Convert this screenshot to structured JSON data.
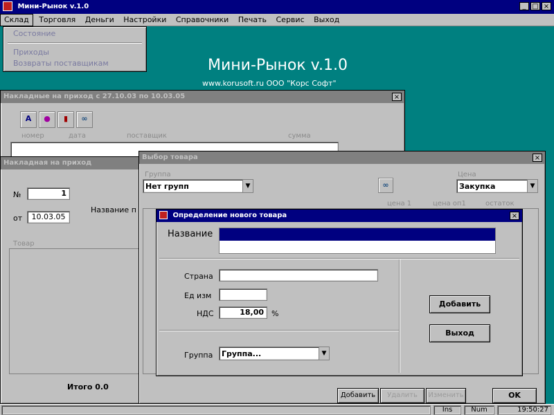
{
  "app": {
    "title": "Мини-Рынок v.1.0",
    "heading": "Мини-Рынок v.1.0",
    "site": "www.korusoft.ru  ООО \"Корс Софт\""
  },
  "menu": {
    "items": [
      "Склад",
      "Торговля",
      "Деньги",
      "Настройки",
      "Справочники",
      "Печать",
      "Сервис",
      "Выход"
    ],
    "dropdown": [
      "Состояние",
      "Приходы",
      "Возвраты поставщикам"
    ]
  },
  "win_invoices": {
    "title": "Накладные на приход с 27.10.03 по 10.03.05",
    "columns": [
      "номер",
      "дата",
      "поставщик",
      "сумма"
    ]
  },
  "win_invoice": {
    "title": "Накладная на приход",
    "num_label": "№",
    "num_value": "1",
    "from_label": "от",
    "date_value": "10.03.05",
    "name_label": "Название п",
    "list_label": "Товар",
    "total_label": "Итого 0.0"
  },
  "win_select": {
    "title": "Выбор товара",
    "group_label": "Группа",
    "group_value": "Нет групп",
    "price_label": "Цена",
    "price_value": "Закупка",
    "col_labels": [
      "цена 1",
      "цена оп1",
      "остаток"
    ],
    "buttons": [
      "Добавить",
      "Удалить",
      "Изменить"
    ],
    "ok": "OK"
  },
  "dialog": {
    "title": "Определение нового товара",
    "name_label": "Название",
    "name_value": "",
    "country_label": "Страна",
    "country_value": "",
    "unit_label": "Ед изм",
    "unit_value": "",
    "vat_label": "НДС",
    "vat_value": "18,00",
    "vat_unit": "%",
    "group_label": "Группа",
    "group_value": "Группа...",
    "add_button": "Добавить",
    "exit_button": "Выход"
  },
  "status": {
    "items": [
      "Ins",
      "Num"
    ],
    "time": "19:50:27"
  }
}
